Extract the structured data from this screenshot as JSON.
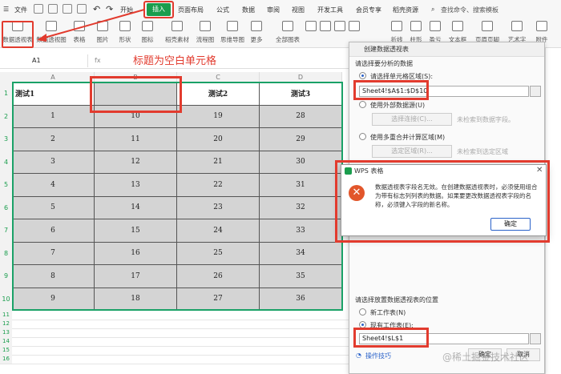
{
  "menu": {
    "file": "文件",
    "tabs": [
      "开始",
      "插入",
      "页面布局",
      "公式",
      "数据",
      "审阅",
      "视图",
      "开发工具",
      "会员专享",
      "稻壳资源"
    ],
    "search_placeholder": "查找命令、搜索模板"
  },
  "ribbon": {
    "buttons": [
      "数据透视表",
      "数据透视图",
      "表格",
      "图片",
      "形状",
      "图标",
      "稻壳素材",
      "流程图",
      "思维导图",
      "更多",
      "全部图表",
      "",
      "",
      "",
      "",
      "折线",
      "柱形",
      "盈亏",
      "文本框",
      "页眉页脚",
      "艺术字",
      "附件"
    ]
  },
  "formula_bar": {
    "cell_ref": "A1",
    "fx": "fx"
  },
  "annotation": "标题为空白单元格",
  "grid": {
    "columns": [
      "A",
      "B",
      "C",
      "D"
    ],
    "row_numbers": [
      "1",
      "2",
      "3",
      "4",
      "5",
      "6",
      "7",
      "8",
      "9",
      "10",
      "11",
      "12",
      "13",
      "14",
      "15",
      "16"
    ],
    "header": [
      "测试1",
      "",
      "测试2",
      "测试3"
    ],
    "rows": [
      [
        "1",
        "10",
        "19",
        "28"
      ],
      [
        "2",
        "11",
        "20",
        "29"
      ],
      [
        "3",
        "12",
        "21",
        "30"
      ],
      [
        "4",
        "13",
        "22",
        "31"
      ],
      [
        "5",
        "14",
        "23",
        "32"
      ],
      [
        "6",
        "15",
        "24",
        "33"
      ],
      [
        "7",
        "16",
        "25",
        "34"
      ],
      [
        "8",
        "17",
        "26",
        "35"
      ],
      [
        "9",
        "18",
        "27",
        "36"
      ]
    ]
  },
  "pivot_dialog": {
    "title": "创建数据透视表",
    "section1": "请选择要分析的数据",
    "opt_range": "请选择单元格区域(S):",
    "range_value": "Sheet4!$A$1:$D$10",
    "opt_external": "使用外部数据源(U)",
    "select_conn": "选择连接(C)...",
    "no_external": "未检索到数据字段。",
    "opt_multi": "使用多重合并计算区域(M)",
    "select_region": "选定区域(R)...",
    "no_region": "未检索到选定区域",
    "section2": "请选择放置数据透视表的位置",
    "opt_new": "新工作表(N)",
    "opt_existing": "现有工作表(E):",
    "existing_value": "Sheet4!$L$1",
    "tips": "操作技巧",
    "ok": "确定",
    "cancel": "取消"
  },
  "error_dialog": {
    "title": "WPS 表格",
    "message": "数据透视表字段名无效。在创建数据透视表时，必须使用组合为带有标志列列表的数据。如果要更改数据透视表字段的名称，必须键入字段的新名称。",
    "ok": "确定"
  },
  "watermark": "@稀土掘金技术社区",
  "colors": {
    "accent_green": "#1a9d4d",
    "annotation_red": "#e23b2e",
    "error_orange": "#e2562b"
  }
}
